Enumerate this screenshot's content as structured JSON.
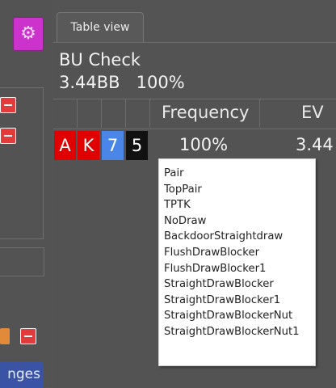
{
  "left_panel": {
    "settings_icon": "gear-icon",
    "changes_tab_label": "nges"
  },
  "tabs": [
    {
      "label": "Table view"
    }
  ],
  "header": {
    "title": "BU Check",
    "subtitle_bb": "3.44BB",
    "subtitle_pct": "100%"
  },
  "table": {
    "columns": [
      "Frequency",
      "EV"
    ],
    "row": {
      "cards": [
        {
          "rank": "A",
          "suit_color": "#e00000"
        },
        {
          "rank": "K",
          "suit_color": "#e00000"
        },
        {
          "rank": "7",
          "suit_color": "#4a86e8"
        },
        {
          "rank": "5",
          "suit_color": "#111111"
        }
      ],
      "frequency": "100%",
      "ev": "3.44"
    }
  },
  "popup": {
    "items": [
      "Pair",
      "TopPair",
      "TPTK",
      "NoDraw",
      "BackdoorStraightdraw",
      "FlushDrawBlocker",
      "FlushDrawBlocker1",
      "StraightDrawBlocker",
      "StraightDrawBlocker1",
      "StraightDrawBlockerNut",
      "StraightDrawBlockerNut1"
    ]
  },
  "colors": {
    "accent_magenta": "#cc33cc",
    "remove_red": "#e23b3b",
    "changes_blue": "#3a53a5",
    "panel_bg": "#545454"
  }
}
